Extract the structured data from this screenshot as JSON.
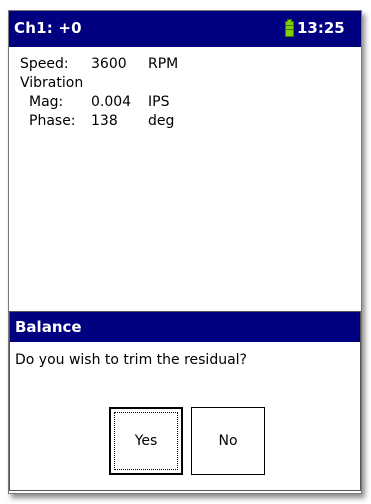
{
  "titlebar": {
    "title": "Ch1: +0",
    "battery_icon": "battery-icon",
    "battery_color": "#7fd000",
    "time": "13:25",
    "background": "#000080"
  },
  "readings": {
    "speed_label": "Speed:",
    "speed_value": "3600",
    "speed_unit": "RPM",
    "vibration_label": "Vibration",
    "mag_label": "Mag:",
    "mag_value": "0.004",
    "mag_unit": "IPS",
    "phase_label": "Phase:",
    "phase_value": "138",
    "phase_unit": "deg"
  },
  "dialog": {
    "title": "Balance",
    "message": "Do you wish to trim the residual?",
    "yes_label": "Yes",
    "no_label": "No",
    "focused_button": "Yes"
  }
}
